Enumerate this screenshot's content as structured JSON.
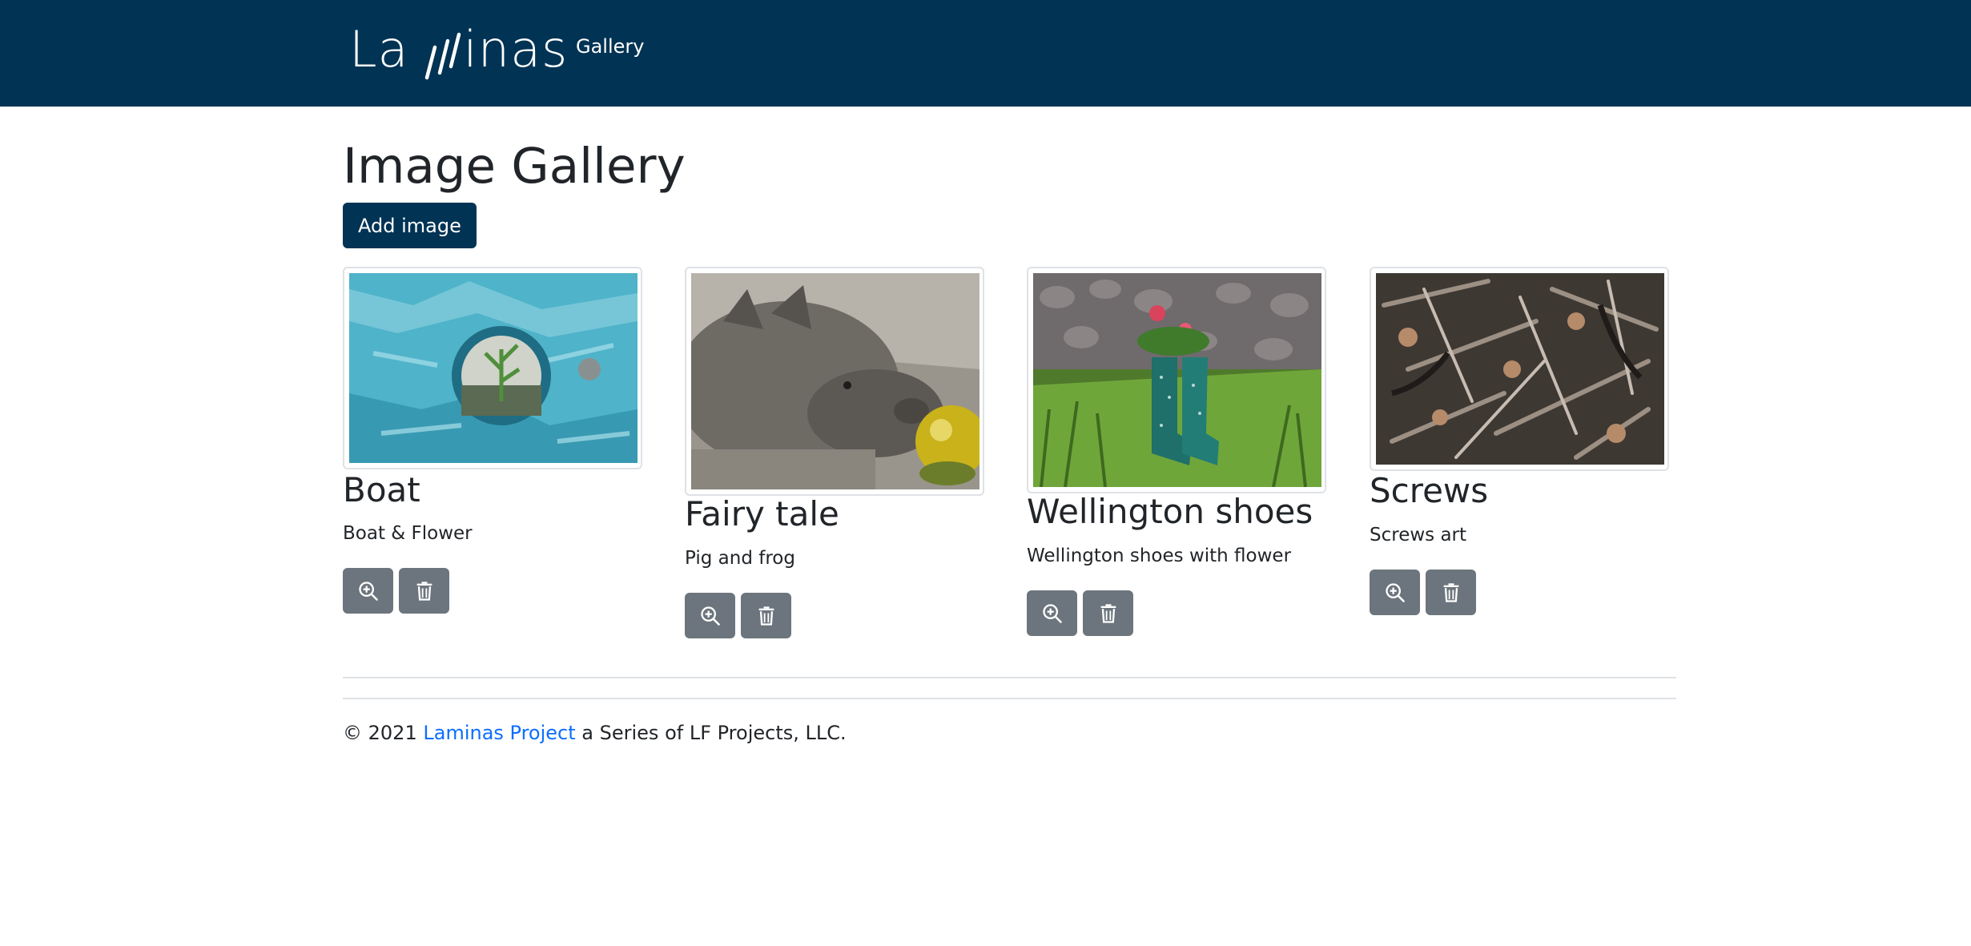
{
  "nav": {
    "brand_left": "La",
    "brand_right": "inas",
    "gallery_link": "Gallery"
  },
  "page": {
    "title": "Image Gallery",
    "add_button": "Add image"
  },
  "images": [
    {
      "title": "Boat",
      "description": "Boat & Flower"
    },
    {
      "title": "Fairy tale",
      "description": "Pig and frog"
    },
    {
      "title": "Wellington shoes",
      "description": "Wellington shoes with flower"
    },
    {
      "title": "Screws",
      "description": "Screws art"
    }
  ],
  "footer": {
    "prefix": "© 2021",
    "link": "Laminas Project",
    "suffix": "a Series of LF Projects, LLC."
  },
  "icons": {
    "view": "zoom-in-icon",
    "delete": "trash-icon"
  },
  "colors": {
    "navbar": "#003354",
    "primary_button": "#003354",
    "secondary_button": "#6c757d",
    "link": "#0d6efd",
    "text": "#212529"
  }
}
